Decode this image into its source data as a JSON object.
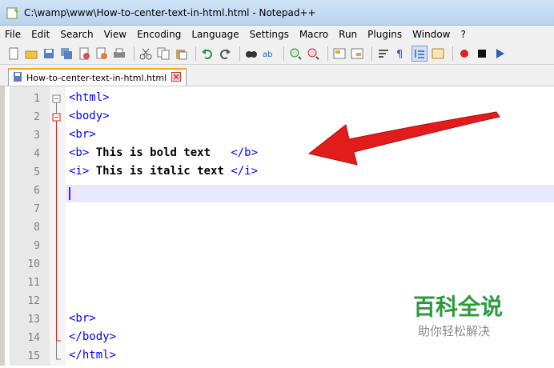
{
  "window": {
    "title": "C:\\wamp\\www\\How-to-center-text-in-html.html - Notepad++"
  },
  "menu": [
    "File",
    "Edit",
    "Search",
    "View",
    "Encoding",
    "Language",
    "Settings",
    "Macro",
    "Run",
    "Plugins",
    "Window",
    "?"
  ],
  "tab": {
    "label": "How-to-center-text-in-html.html"
  },
  "lines": [
    {
      "no": "1",
      "code": "<html>"
    },
    {
      "no": "2",
      "code": "<body>"
    },
    {
      "no": "3",
      "code": "<br>"
    },
    {
      "no": "4",
      "open": "<b>",
      "text": " This is bold text   ",
      "close": "</b>"
    },
    {
      "no": "5",
      "open": "<i>",
      "text": " This is italic text ",
      "close": "</i>"
    },
    {
      "no": "6",
      "code": ""
    },
    {
      "no": "7",
      "code": ""
    },
    {
      "no": "8",
      "code": ""
    },
    {
      "no": "9",
      "code": ""
    },
    {
      "no": "10",
      "code": ""
    },
    {
      "no": "11",
      "code": ""
    },
    {
      "no": "12",
      "code": ""
    },
    {
      "no": "13",
      "code": "<br>"
    },
    {
      "no": "14",
      "code": "</body>"
    },
    {
      "no": "15",
      "code": "</html>"
    }
  ],
  "watermark": {
    "main": "百科全说",
    "sub": "助你轻松解决"
  },
  "colors": {
    "tag": "#0000ff",
    "arrow": "#e21b1b",
    "watermark": "#2d9a3e"
  }
}
